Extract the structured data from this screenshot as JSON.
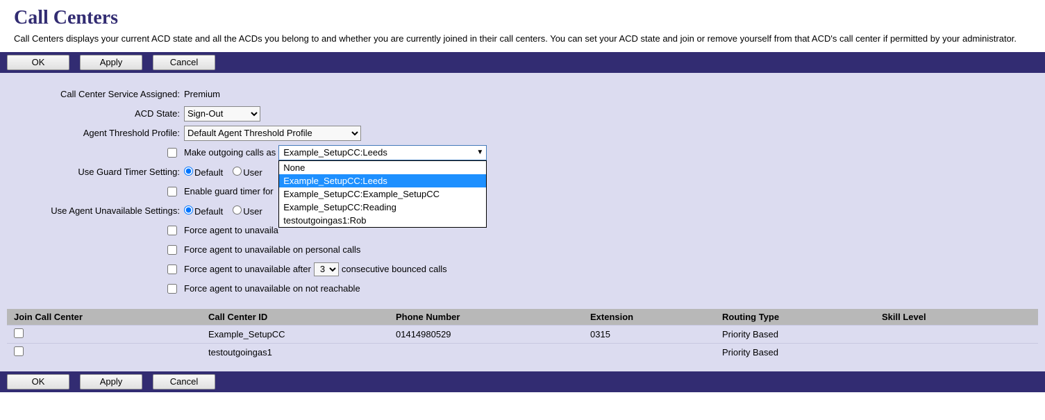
{
  "header": {
    "title": "Call Centers",
    "description": "Call Centers displays your current ACD state and all the ACDs you belong to and whether you are currently joined in their call centers. You can set your ACD state and join or remove yourself from that ACD's call center if permitted by your administrator."
  },
  "buttons": {
    "ok": "OK",
    "apply": "Apply",
    "cancel": "Cancel"
  },
  "form": {
    "service_label": "Call Center Service Assigned:",
    "service_value": "Premium",
    "acd_label": "ACD State:",
    "acd_value": "Sign-Out",
    "threshold_label": "Agent Threshold Profile:",
    "threshold_value": "Default Agent Threshold Profile",
    "outgoing_label": "Make outgoing calls as",
    "outgoing_selected": "Example_SetupCC:Leeds",
    "outgoing_options": [
      "None",
      "Example_SetupCC:Leeds",
      "Example_SetupCC:Example_SetupCC",
      "Example_SetupCC:Reading",
      "testoutgoingas1:Rob"
    ],
    "guard_label": "Use Guard Timer Setting:",
    "radio_default": "Default",
    "radio_user": "User",
    "enable_guard_label": "Enable guard timer for",
    "unavail_label": "Use Agent Unavailable Settings:",
    "force_dnd": "Force agent to unavaila",
    "force_personal": "Force agent to unavailable on personal calls",
    "force_bounced_pre": "Force agent to unavailable after",
    "force_bounced_value": "3",
    "force_bounced_post": "consecutive bounced calls",
    "force_unreachable": "Force agent to unavailable on not reachable"
  },
  "table": {
    "headers": {
      "join": "Join Call Center",
      "id": "Call Center ID",
      "phone": "Phone Number",
      "ext": "Extension",
      "routing": "Routing Type",
      "skill": "Skill Level"
    },
    "rows": [
      {
        "joined": false,
        "id": "Example_SetupCC",
        "phone": "01414980529",
        "ext": "0315",
        "routing": "Priority Based",
        "skill": ""
      },
      {
        "joined": false,
        "id": "testoutgoingas1",
        "phone": "",
        "ext": "",
        "routing": "Priority Based",
        "skill": ""
      }
    ]
  }
}
